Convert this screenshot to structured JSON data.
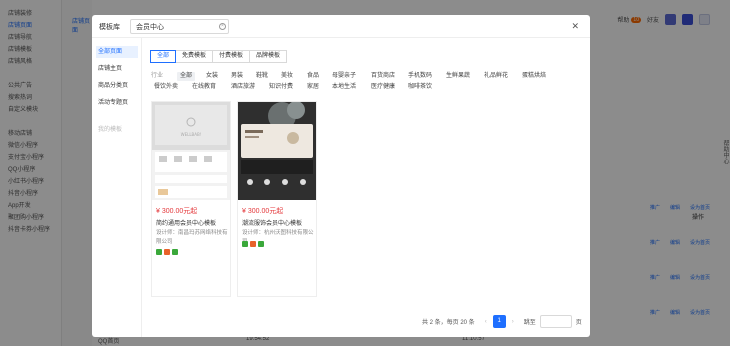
{
  "background": {
    "sidebar": [
      {
        "label": "店铺装修"
      },
      {
        "label": "店铺页面",
        "active": true
      },
      {
        "label": "店铺导航"
      },
      {
        "label": "店铺模板"
      },
      {
        "label": "店铺风格"
      },
      {
        "label": ""
      },
      {
        "label": "公共广告"
      },
      {
        "label": "搜索热词"
      },
      {
        "label": "自定义模块"
      },
      {
        "label": ""
      },
      {
        "label": "移动店铺"
      },
      {
        "label": "微信小程序"
      },
      {
        "label": "支付宝小程序"
      },
      {
        "label": "QQ小程序"
      },
      {
        "label": "小红书小程序"
      },
      {
        "label": "抖音小程序"
      },
      {
        "label": "App开发"
      },
      {
        "label": "聚团购小程序"
      },
      {
        "label": "抖音卡券小程序"
      }
    ],
    "subnav_label": "店铺页面",
    "top_right": {
      "help": "帮助",
      "badge": "10",
      "friend": "好友"
    },
    "operation_header": "操作",
    "help_side": "帮助中心",
    "row_links": [
      "推广",
      "编辑",
      "设为首页",
      "…"
    ],
    "footer_left": "QQ首页",
    "footer_mid": "19:54:52",
    "footer_right": "11:10:57"
  },
  "modal": {
    "title": "模板库",
    "search_value": "会员中心",
    "close_icon": "close-icon",
    "nav": [
      {
        "label": "全部页面",
        "active": true
      },
      {
        "label": "店铺主页"
      },
      {
        "label": "商品分类页"
      },
      {
        "label": "活动专题页"
      },
      {
        "label": "我的模板",
        "muted": true
      }
    ],
    "tabs": [
      {
        "label": "全部",
        "active": true
      },
      {
        "label": "免费模板"
      },
      {
        "label": "付费模板"
      },
      {
        "label": "品牌模板"
      }
    ],
    "category_label": "行业",
    "categories": [
      {
        "label": "全部",
        "active": true
      },
      {
        "label": "女装"
      },
      {
        "label": "男装"
      },
      {
        "label": "鞋靴"
      },
      {
        "label": "美妆"
      },
      {
        "label": "食品"
      },
      {
        "label": "母婴亲子"
      },
      {
        "label": "百货商店"
      },
      {
        "label": "手机数码"
      },
      {
        "label": "生鲜果蔬"
      },
      {
        "label": "礼品鲜花"
      },
      {
        "label": "蛋糕烘焙"
      },
      {
        "label": "餐饮外卖"
      },
      {
        "label": "在线教育"
      },
      {
        "label": "酒店旅游"
      },
      {
        "label": "知识付费"
      },
      {
        "label": "家居"
      },
      {
        "label": "本地生活"
      },
      {
        "label": "医疗健康"
      },
      {
        "label": "咖啡茶饮"
      }
    ],
    "templates": [
      {
        "price": "¥ 300.00元起",
        "name": "简约通用会员中心模板",
        "designer": "设计师：南昌玛苏网络科技有限公司",
        "preview_brand": "WELLBAB!",
        "tags": [
          "#3aa83a",
          "#e8622a",
          "#3aa83a"
        ]
      },
      {
        "price": "¥ 300.00元起",
        "name": "潮流服饰会员中心模板",
        "designer": "设计师：杭州沃图科技有限公司",
        "tags": [
          "#3aa83a",
          "#e8622a",
          "#3aa83a"
        ]
      }
    ],
    "pagination": {
      "summary": "共 2 条，每页 20 条",
      "prev": "‹",
      "current": "1",
      "next": "›",
      "jump_label": "跳至",
      "page_suffix": "页"
    }
  }
}
